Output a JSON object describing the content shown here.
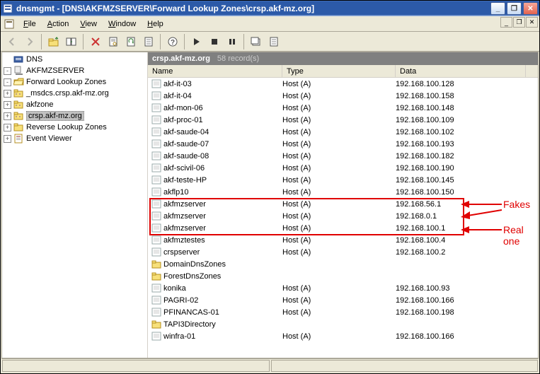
{
  "title": "dnsmgmt - [DNS\\AKFMZSERVER\\Forward Lookup Zones\\crsp.akf-mz.org]",
  "menus": {
    "file": "File",
    "action": "Action",
    "view": "View",
    "window": "Window",
    "help": "Help"
  },
  "tree": {
    "root": "DNS",
    "server": "AKFMZSERVER",
    "flz": "Forward Lookup Zones",
    "z1": "_msdcs.crsp.akf-mz.org",
    "z2": "akfzone",
    "z3": "crsp.akf-mz.org",
    "rlz": "Reverse Lookup Zones",
    "ev": "Event Viewer"
  },
  "content": {
    "zone": "crsp.akf-mz.org",
    "count_text": "58 record(s)",
    "cols": {
      "name": "Name",
      "type": "Type",
      "data": "Data"
    },
    "records": [
      {
        "name": "akf-it-03",
        "type": "Host (A)",
        "data": "192.168.100.128",
        "icon": "record"
      },
      {
        "name": "akf-it-04",
        "type": "Host (A)",
        "data": "192.168.100.158",
        "icon": "record"
      },
      {
        "name": "akf-mon-06",
        "type": "Host (A)",
        "data": "192.168.100.148",
        "icon": "record"
      },
      {
        "name": "akf-proc-01",
        "type": "Host (A)",
        "data": "192.168.100.109",
        "icon": "record"
      },
      {
        "name": "akf-saude-04",
        "type": "Host (A)",
        "data": "192.168.100.102",
        "icon": "record"
      },
      {
        "name": "akf-saude-07",
        "type": "Host (A)",
        "data": "192.168.100.193",
        "icon": "record"
      },
      {
        "name": "akf-saude-08",
        "type": "Host (A)",
        "data": "192.168.100.182",
        "icon": "record"
      },
      {
        "name": "akf-scivil-06",
        "type": "Host (A)",
        "data": "192.168.100.190",
        "icon": "record"
      },
      {
        "name": "akf-teste-HP",
        "type": "Host (A)",
        "data": "192.168.100.145",
        "icon": "record"
      },
      {
        "name": "akflp10",
        "type": "Host (A)",
        "data": "192.168.100.150",
        "icon": "record"
      },
      {
        "name": "akfmzserver",
        "type": "Host (A)",
        "data": "192.168.56.1",
        "icon": "record"
      },
      {
        "name": "akfmzserver",
        "type": "Host (A)",
        "data": "192.168.0.1",
        "icon": "record"
      },
      {
        "name": "akfmzserver",
        "type": "Host (A)",
        "data": "192.168.100.1",
        "icon": "record"
      },
      {
        "name": "akfmztestes",
        "type": "Host (A)",
        "data": "192.168.100.4",
        "icon": "record"
      },
      {
        "name": "crspserver",
        "type": "Host (A)",
        "data": "192.168.100.2",
        "icon": "record"
      },
      {
        "name": "DomainDnsZones",
        "type": "",
        "data": "",
        "icon": "folder"
      },
      {
        "name": "ForestDnsZones",
        "type": "",
        "data": "",
        "icon": "folder"
      },
      {
        "name": "konika",
        "type": "Host (A)",
        "data": "192.168.100.93",
        "icon": "record"
      },
      {
        "name": "PAGRI-02",
        "type": "Host (A)",
        "data": "192.168.100.166",
        "icon": "record"
      },
      {
        "name": "PFINANCAS-01",
        "type": "Host (A)",
        "data": "192.168.100.198",
        "icon": "record"
      },
      {
        "name": "TAPI3Directory",
        "type": "",
        "data": "",
        "icon": "folder"
      },
      {
        "name": "winfra-01",
        "type": "Host (A)",
        "data": "192.168.100.166",
        "icon": "record"
      }
    ]
  },
  "annotations": {
    "fakes": "Fakes",
    "real": "Real one"
  }
}
